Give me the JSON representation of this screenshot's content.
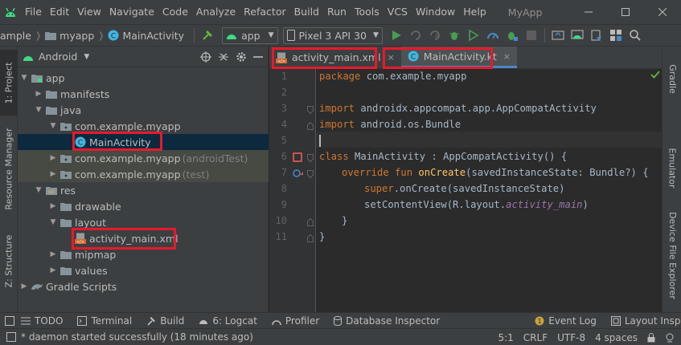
{
  "menu": {
    "items": [
      "File",
      "Edit",
      "View",
      "Navigate",
      "Code",
      "Analyze",
      "Refactor",
      "Build",
      "Run",
      "Tools",
      "VCS",
      "Window",
      "Help"
    ],
    "app_title": "MyApp"
  },
  "toolbar": {
    "breadcrumb": [
      "ample",
      "myapp",
      "MainActivity"
    ],
    "run_config": "app",
    "device": "Pixel 3 API 30"
  },
  "left_tabs": {
    "project": "1: Project",
    "resource_manager": "Resource Manager",
    "structure": "Z: Structure"
  },
  "right_tabs": {
    "gradle": "Gradle",
    "emulator": "Emulator",
    "device_explorer": "Device File Explorer"
  },
  "project_panel": {
    "view": "Android",
    "tree": [
      {
        "label": "app",
        "extra": ""
      },
      {
        "label": "manifests",
        "extra": ""
      },
      {
        "label": "java",
        "extra": ""
      },
      {
        "label": "com.example.myapp",
        "extra": ""
      },
      {
        "label": "MainActivity",
        "extra": ""
      },
      {
        "label": "com.example.myapp",
        "extra": "(androidTest)"
      },
      {
        "label": "com.example.myapp",
        "extra": "(test)"
      },
      {
        "label": "res",
        "extra": ""
      },
      {
        "label": "drawable",
        "extra": ""
      },
      {
        "label": "layout",
        "extra": ""
      },
      {
        "label": "activity_main.xml",
        "extra": ""
      },
      {
        "label": "mipmap",
        "extra": ""
      },
      {
        "label": "values",
        "extra": ""
      },
      {
        "label": "Gradle Scripts",
        "extra": ""
      }
    ]
  },
  "editor": {
    "tabs": [
      {
        "label": "activity_main.xml",
        "close": "×"
      },
      {
        "label": "MainActivity.kt",
        "close": "×"
      }
    ],
    "line_numbers": [
      "1",
      "2",
      "3",
      "4",
      "5",
      "6",
      "7",
      "8",
      "9",
      "10",
      "11"
    ],
    "code": {
      "l1_kw": "package",
      "l1_rest": " com.example.myapp",
      "l3_kw": "import",
      "l3_rest": " androidx.appcompat.app.AppCompatActivity",
      "l4_kw": "import",
      "l4_rest": " android.os.Bundle",
      "l6_kw": "class",
      "l6_rest": " MainActivity : AppCompatActivity() {",
      "l7_kw1": "override fun",
      "l7_fn": "onCreate",
      "l7_rest": "(savedInstanceState: Bundle?) {",
      "l8_kw": "super",
      "l8_rest": ".onCreate(savedInstanceState)",
      "l9_pre": "setContentView(R.layout.",
      "l9_it": "activity_main",
      "l9_post": ")",
      "l10": "}",
      "l11": "}"
    }
  },
  "bottom_tools": [
    "TODO",
    "Terminal",
    "Build",
    "6: Logcat",
    "Profiler",
    "Database Inspector",
    "Event Log",
    "Layout Inspector"
  ],
  "status": {
    "message": "* daemon started successfully (18 minutes ago)",
    "position": "5:1",
    "line_sep": "CRLF",
    "encoding": "UTF-8",
    "indent": "4 spaces"
  },
  "colors": {
    "highlight_box": "#e8192c",
    "selection": "#0d293e",
    "keyword": "#cc7832",
    "function": "#ffc66d"
  }
}
